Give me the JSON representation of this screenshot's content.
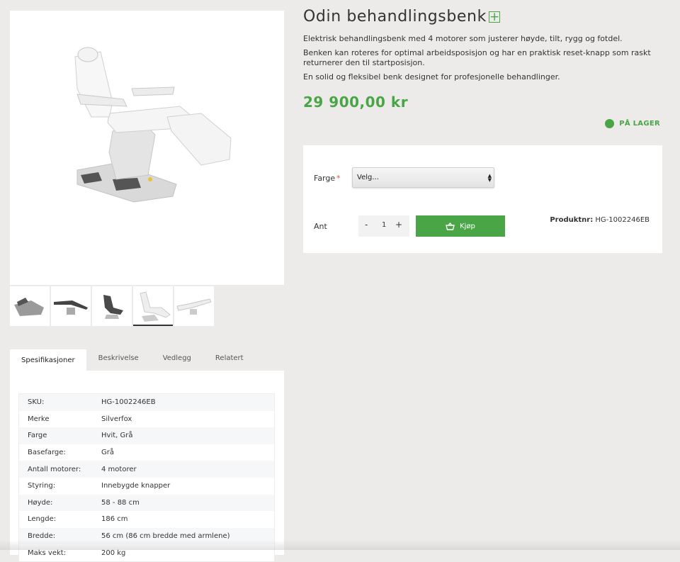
{
  "product": {
    "title": "Odin behandlingsbenk",
    "description": [
      "Elektrisk behandlingsbenk med 4 motorer som justerer høyde, tilt, rygg og fotdel.",
      "Benken kan roteres for optimal arbeidsposisjon og har en praktisk reset-knapp som raskt returnerer den til startposisjon.",
      "En solid og fleksibel benk designet for profesjonelle behandlinger."
    ],
    "price": "29 900,00 kr",
    "stock_status": "PÅ LAGER"
  },
  "purchase": {
    "color_label": "Farge",
    "required_mark": "*",
    "color_select_value": "Velg...",
    "qty_label": "Ant",
    "qty_minus": "-",
    "qty_value": "1",
    "qty_plus": "+",
    "buy_label": "Kjøp",
    "product_no_label": "Produktnr:",
    "product_no_value": "HG-1002246EB"
  },
  "tabs": [
    "Spesifikasjoner",
    "Beskrivelse",
    "Vedlegg",
    "Relatert"
  ],
  "specs": [
    {
      "k": "SKU:",
      "v": "HG-1002246EB"
    },
    {
      "k": "Merke",
      "v": "Silverfox"
    },
    {
      "k": "Farge",
      "v": "Hvit, Grå"
    },
    {
      "k": "Basefarge:",
      "v": "Grå"
    },
    {
      "k": "Antall motorer:",
      "v": "4 motorer"
    },
    {
      "k": "Styring:",
      "v": "Innebygde knapper"
    },
    {
      "k": "Høyde:",
      "v": "58 - 88 cm"
    },
    {
      "k": "Lengde:",
      "v": "186 cm"
    },
    {
      "k": "Bredde:",
      "v": "56 cm (86 cm bredde med armlene)"
    },
    {
      "k": "Maks vekt:",
      "v": "200 kg"
    }
  ],
  "colors": {
    "accent": "#4aa546",
    "background": "#ecebea"
  }
}
